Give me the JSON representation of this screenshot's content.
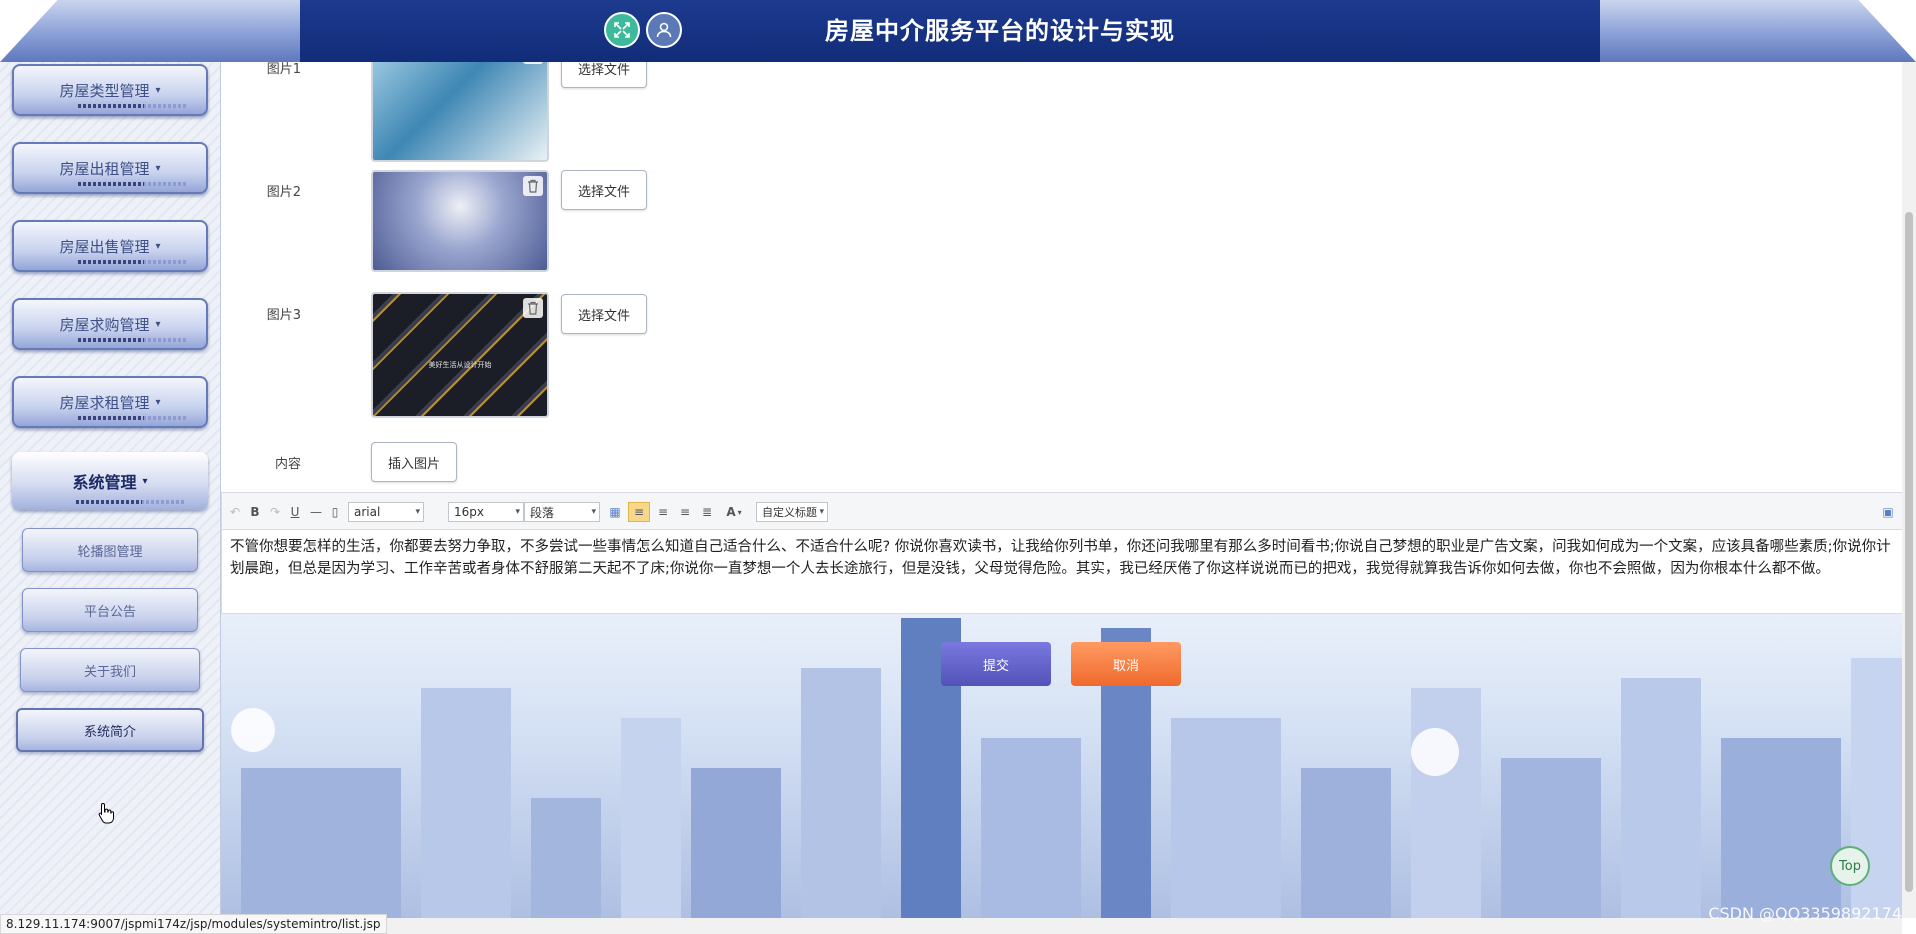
{
  "header": {
    "title": "房屋中介服务平台的设计与实现",
    "fullscreen_icon": "expand-icon",
    "user_icon": "user-icon",
    "brand_color": "#112c78"
  },
  "sidebar": {
    "menus": [
      {
        "label": "房屋类型管理"
      },
      {
        "label": "房屋出租管理"
      },
      {
        "label": "房屋出售管理"
      },
      {
        "label": "房屋求购管理"
      },
      {
        "label": "房屋求租管理"
      },
      {
        "label": "系统管理"
      }
    ],
    "submenu": [
      {
        "label": "轮播图管理"
      },
      {
        "label": "平台公告"
      },
      {
        "label": "关于我们"
      },
      {
        "label": "系统简介"
      }
    ]
  },
  "form": {
    "images": [
      {
        "label": "图片1",
        "button": "选择文件"
      },
      {
        "label": "图片2",
        "button": "选择文件"
      },
      {
        "label": "图片3",
        "button": "选择文件",
        "overlay_text": "美好生活从设计开始"
      }
    ],
    "content_label": "内容",
    "insert_image": "插入图片",
    "toolbar": {
      "font": "arial",
      "size": "16px",
      "paragraph": "段落",
      "custom_title": "自定义标题",
      "bold": "B",
      "underline": "U",
      "font_color": "A"
    },
    "content_text": "不管你想要怎样的生活，你都要去努力争取，不多尝试一些事情怎么知道自己适合什么、不适合什么呢? 你说你喜欢读书，让我给你列书单，你还问我哪里有那么多时间看书;你说自己梦想的职业是广告文案，问我如何成为一个文案，应该具备哪些素质;你说你计划晨跑，但总是因为学习、工作辛苦或者身体不舒服第二天起不了床;你说你一直梦想一个人去长途旅行，但是没钱，父母觉得危险。其实，我已经厌倦了你这样说说而已的把戏，我觉得就算我告诉你如何去做，你也不会照做，因为你根本什么都不做。",
    "submit": "提交",
    "cancel": "取消"
  },
  "top_button": "Top",
  "status_url": "8.129.11.174:9007/jspmi174z/jsp/modules/systemintro/list.jsp",
  "watermark": "CSDN @QQ3359892174"
}
